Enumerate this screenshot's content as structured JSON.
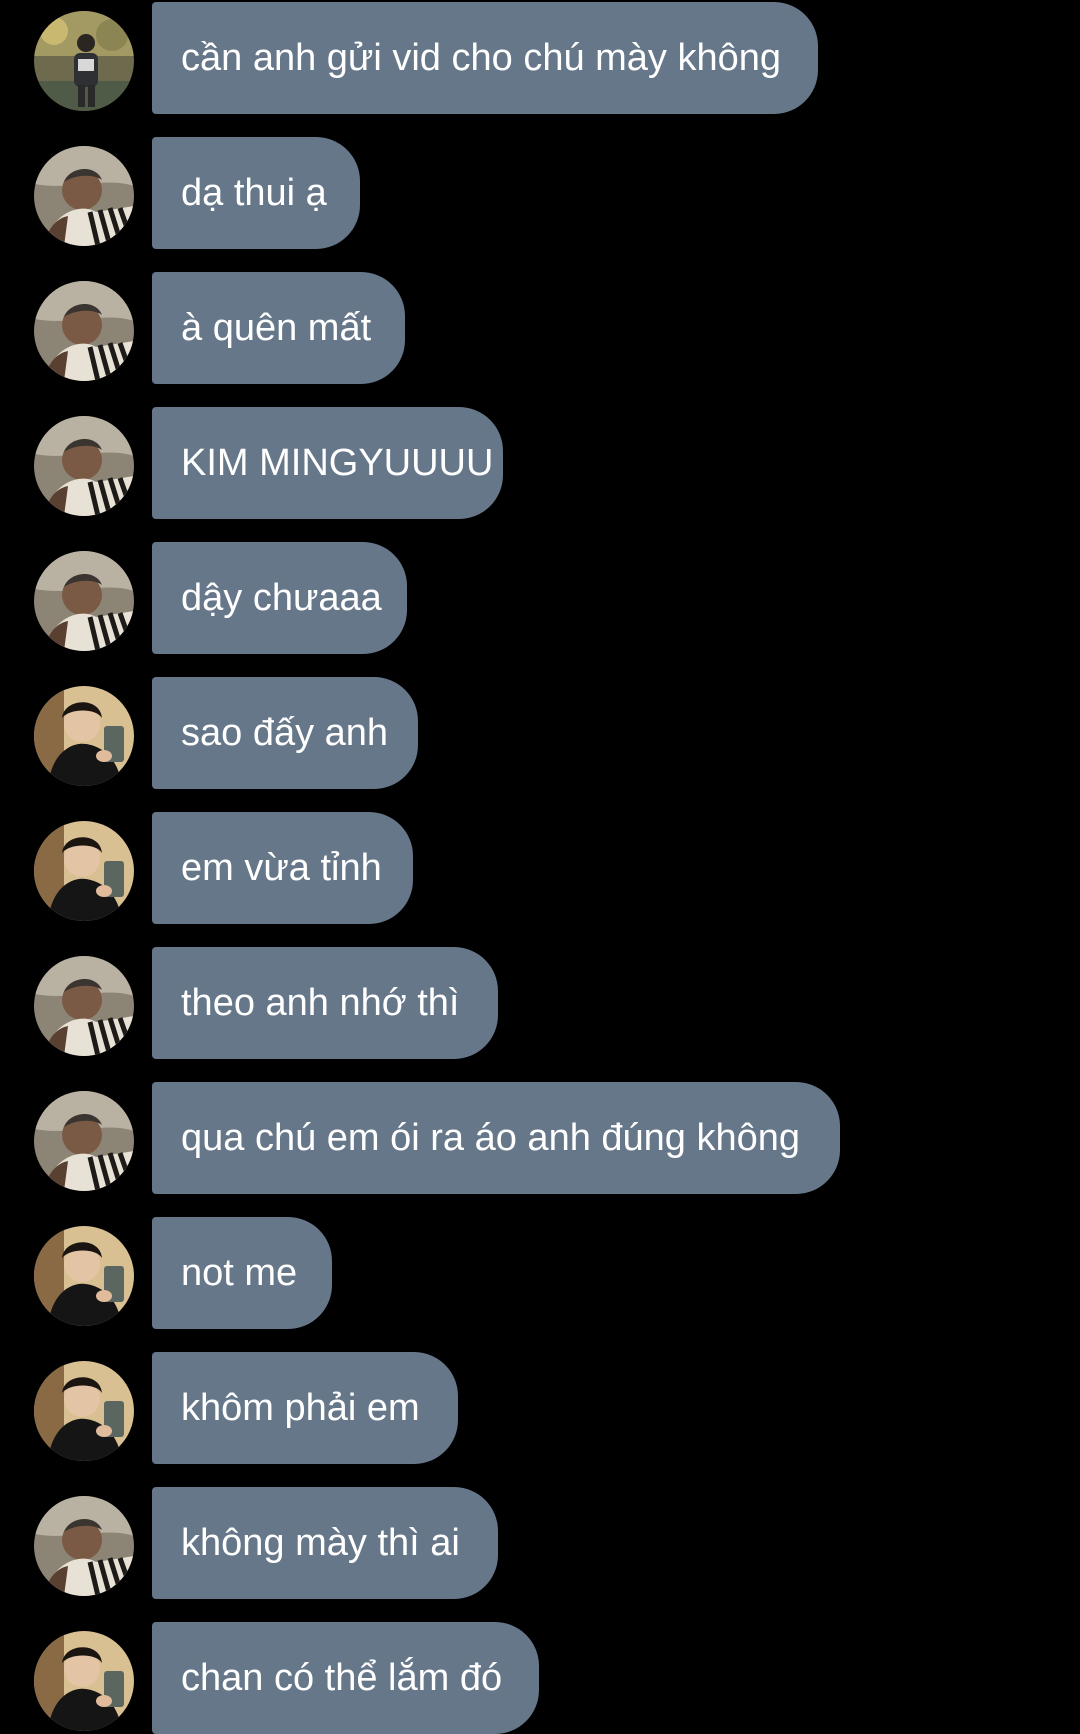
{
  "colors": {
    "background": "#000000",
    "bubble": "#66778a",
    "text": "#ffffff"
  },
  "messages": [
    {
      "sender": "avatar-a",
      "text": "cần anh gửi vid cho chú mày không"
    },
    {
      "sender": "avatar-b",
      "text": "dạ thui ạ"
    },
    {
      "sender": "avatar-b",
      "text": "à quên mất"
    },
    {
      "sender": "avatar-b",
      "text": "KIM MINGYUUUU"
    },
    {
      "sender": "avatar-b",
      "text": "dậy chưaaa"
    },
    {
      "sender": "avatar-c",
      "text": "sao đấy anh"
    },
    {
      "sender": "avatar-c",
      "text": "em vừa tỉnh"
    },
    {
      "sender": "avatar-b",
      "text": "theo anh nhớ thì"
    },
    {
      "sender": "avatar-b",
      "text": "qua chú em ói ra áo anh đúng không"
    },
    {
      "sender": "avatar-c",
      "text": "not me"
    },
    {
      "sender": "avatar-c",
      "text": "khôm phải em"
    },
    {
      "sender": "avatar-b",
      "text": "không mày thì ai"
    },
    {
      "sender": "avatar-c",
      "text": "chan có thể lắm đó"
    }
  ]
}
